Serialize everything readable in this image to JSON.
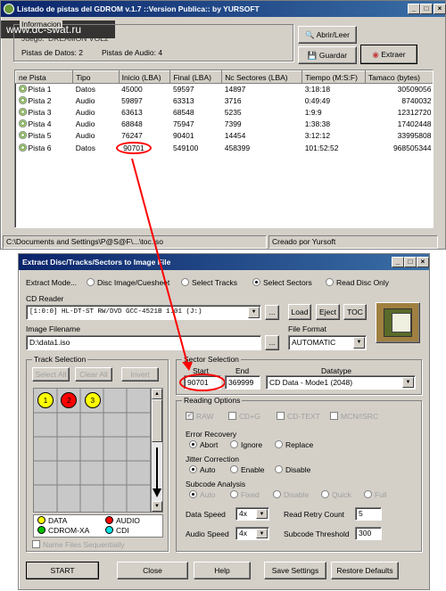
{
  "watermark": "www.dc-swat.ru",
  "win1": {
    "title": "Listado de pistas del GDROM v.1.7     ::Version Publica:: by YURSOFT",
    "info_group": "Informacion",
    "juego_label": "Juego:",
    "juego_value": "DREAMON VOL2",
    "pistas_datos": "Pistas de Datos: 2",
    "pistas_audio": "Pistas de Audio: 4",
    "btn_abrir": "Abrir/Leer",
    "btn_guardar": "Guardar",
    "btn_extraer": "Extraer",
    "columns": [
      "ne Pista",
      "Tipo",
      "Inicio (LBA)",
      "Final (LBA)",
      "Nc Sectores (LBA)",
      "Tiempo (M:S:F)",
      "Tamaco (bytes)"
    ],
    "rows": [
      [
        "Pista 1",
        "Datos",
        "45000",
        "59597",
        "14897",
        "3:18:18",
        "30509056"
      ],
      [
        "Pista 2",
        "Audio",
        "59897",
        "63313",
        "3716",
        "0:49:49",
        "8740032"
      ],
      [
        "Pista 3",
        "Audio",
        "63613",
        "68548",
        "5235",
        "1:9:9",
        "12312720"
      ],
      [
        "Pista 4",
        "Audio",
        "68848",
        "75947",
        "7399",
        "1:38:38",
        "17402448"
      ],
      [
        "Pista 5",
        "Audio",
        "76247",
        "90401",
        "14454",
        "3:12:12",
        "33995808"
      ],
      [
        "Pista 6",
        "Datos",
        "90701",
        "549100",
        "458399",
        "101:52:52",
        "968505344"
      ]
    ],
    "status_path": "C:\\Documents and Settings\\P@S@F\\...\\toc.iso",
    "status_credit": "Creado por Yursoft"
  },
  "win2": {
    "title": "Extract Disc/Tracks/Sectors to Image File",
    "mode_label": "Extract Mode...",
    "modes": [
      "Disc Image/Cuesheet",
      "Select Tracks",
      "Select Sectors",
      "Read Disc Only"
    ],
    "cd_reader_label": "CD Reader",
    "cd_reader_value": "[1:0:0] HL-DT-ST RW/DVD GCC-4521B 1.01 (J:)",
    "btn_browse": "...",
    "btn_load": "Load",
    "btn_eject": "Eject",
    "btn_toc": "TOC",
    "image_filename_label": "Image Filename",
    "image_filename_value": "D:\\data1.iso",
    "file_format_label": "File Format",
    "file_format_value": "AUTOMATIC",
    "track_group": "Track Selection",
    "btn_select_all": "Select All",
    "btn_clear_all": "Clear All",
    "btn_invert": "Invert",
    "tracks": [
      "1",
      "2",
      "3"
    ],
    "legend": [
      "DATA",
      "AUDIO",
      "CDROM-XA",
      "CDI"
    ],
    "name_files": "Name Files Sequentially",
    "sector_group": "Sector Selection",
    "start_label": "Start",
    "end_label": "End",
    "datatype_label": "Datatype",
    "start_value": "90701",
    "end_value": "369999",
    "datatype_value": "CD Data - Mode1 (2048)",
    "reading_group": "Reading Options",
    "chk_raw": "RAW",
    "chk_cdg": "CD+G",
    "chk_cdtext": "CD-TEXT",
    "chk_mcn": "MCN/ISRC",
    "error_recovery_label": "Error Recovery",
    "error_opts": [
      "Abort",
      "Ignore",
      "Replace"
    ],
    "jitter_label": "Jitter Correction",
    "jitter_opts": [
      "Auto",
      "Enable",
      "Disable"
    ],
    "subcode_label": "Subcode Analysis",
    "subcode_opts": [
      "Auto",
      "Fixed",
      "Disable",
      "Quick",
      "Full"
    ],
    "data_speed_label": "Data Speed",
    "data_speed_value": "4x",
    "audio_speed_label": "Audio Speed",
    "audio_speed_value": "4x",
    "read_retry_label": "Read Retry Count",
    "read_retry_value": "5",
    "subcode_threshold_label": "Subcode Threshold",
    "subcode_threshold_value": "300",
    "btn_start": "START",
    "btn_close": "Close",
    "btn_help": "Help",
    "btn_save": "Save Settings",
    "btn_restore": "Restore Defaults"
  },
  "colors": {
    "title_start": "#0a246a",
    "title_end": "#3a6ea5",
    "highlight": "#ff0000",
    "data": "#ffff00",
    "audio": "#ff0000",
    "cdromxa": "#00c000",
    "cdi": "#00e0e0"
  }
}
